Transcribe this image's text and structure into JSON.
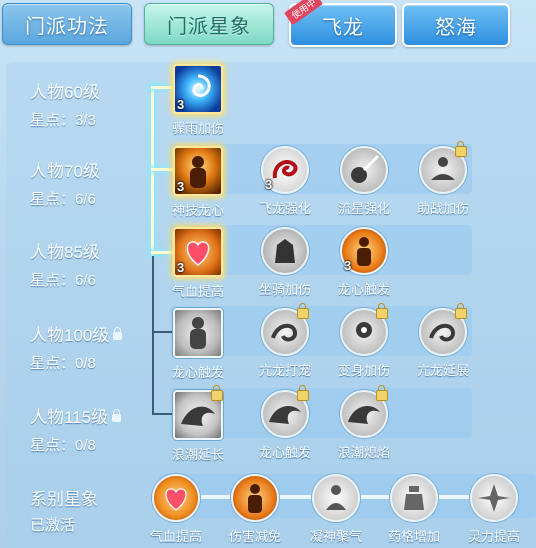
{
  "tabs": [
    {
      "label": "门派功法"
    },
    {
      "label": "门派星象"
    },
    {
      "label": "飞龙",
      "badge": "使用中"
    },
    {
      "label": "怒海"
    }
  ],
  "rows": [
    {
      "level": "人物60级",
      "points": "星点：3/3",
      "locked": false
    },
    {
      "level": "人物70级",
      "points": "星点：6/6",
      "locked": false
    },
    {
      "level": "人物85级",
      "points": "星点：6/6",
      "locked": false
    },
    {
      "level": "人物100级",
      "points": "星点：0/8",
      "locked": true
    },
    {
      "level": "人物115级",
      "points": "星点：0/8",
      "locked": true
    }
  ],
  "nodes": {
    "r1": [
      {
        "label": "骤雨加伤",
        "count": "3",
        "icon": "storm-icon"
      }
    ],
    "r2": [
      {
        "label": "神技龙心",
        "count": "3",
        "icon": "dragon-heart-icon"
      },
      {
        "label": "飞龙强化",
        "count": "3",
        "icon": "dragon-icon"
      },
      {
        "label": "流星强化",
        "count": "",
        "icon": "meteor-icon"
      },
      {
        "label": "助战加伤",
        "count": "",
        "icon": "meditate-icon"
      }
    ],
    "r3": [
      {
        "label": "气血提高",
        "count": "3",
        "icon": "heart-icon"
      },
      {
        "label": "坐骑加伤",
        "count": "",
        "icon": "beast-icon"
      },
      {
        "label": "龙心触发",
        "count": "3",
        "icon": "fire-figure-icon"
      }
    ],
    "r4": [
      {
        "label": "龙心触发",
        "count": "",
        "icon": "figure-icon"
      },
      {
        "label": "亢龙打宠",
        "count": "",
        "icon": "dragon-coil-icon"
      },
      {
        "label": "变身加伤",
        "count": "",
        "icon": "transform-icon"
      },
      {
        "label": "亢龙延展",
        "count": "",
        "icon": "dragon-coil-icon"
      }
    ],
    "r5": [
      {
        "label": "浪潮延长",
        "count": "",
        "icon": "wave-icon"
      },
      {
        "label": "龙心触发",
        "count": "",
        "icon": "wave-icon"
      },
      {
        "label": "浪潮熄焰",
        "count": "",
        "icon": "wave-icon"
      }
    ]
  },
  "series": {
    "title": "系别星象",
    "status": "已激活",
    "items": [
      {
        "label": "气血提高",
        "icon": "heart-icon"
      },
      {
        "label": "伤害减免",
        "icon": "shield-figure-icon"
      },
      {
        "label": "凝神聚气",
        "icon": "focus-icon"
      },
      {
        "label": "药格增加",
        "icon": "potion-icon"
      },
      {
        "label": "灵力提高",
        "icon": "spirit-icon"
      }
    ]
  },
  "colors": {
    "accent_tab": "#7fd9c4",
    "active_line": "#fffbd0",
    "glow": "#8fe7ff"
  }
}
